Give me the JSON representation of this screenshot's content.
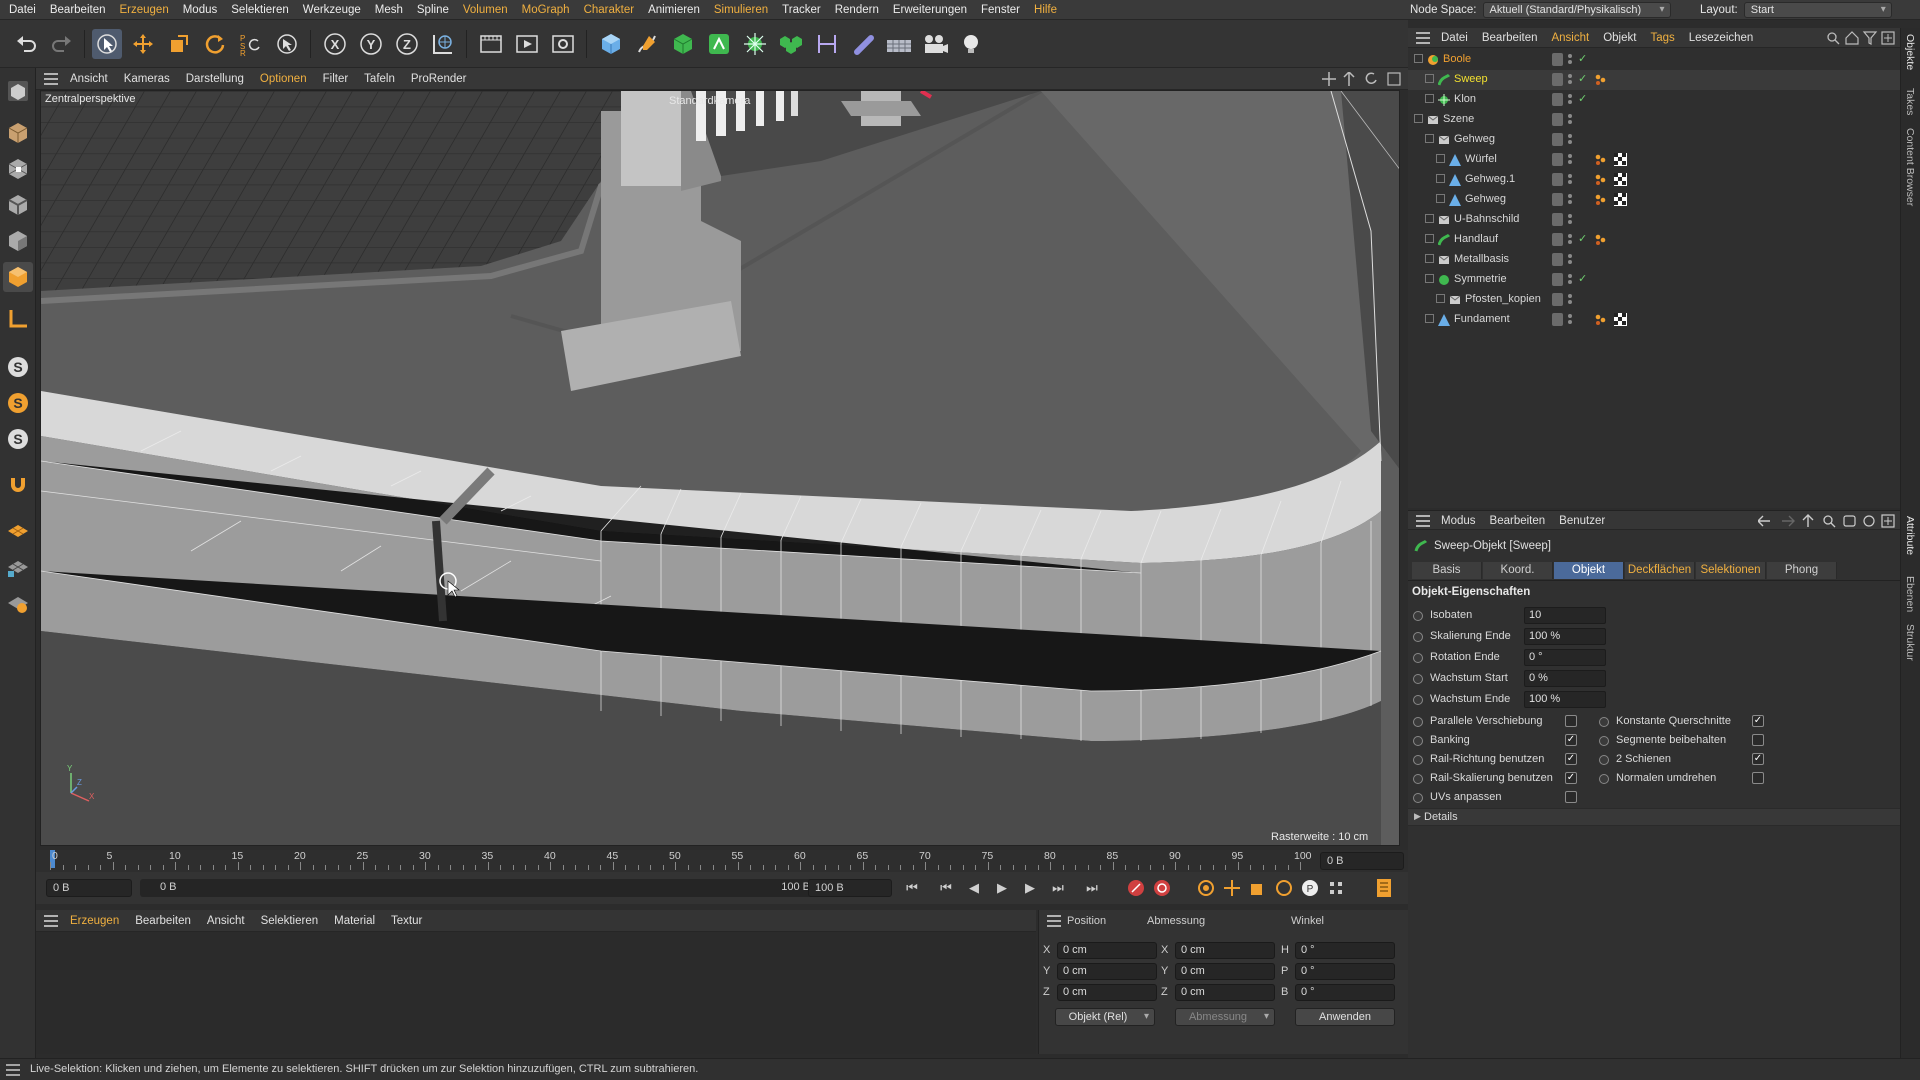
{
  "menubar": {
    "items": [
      "Datei",
      "Bearbeiten",
      "Erzeugen",
      "Modus",
      "Selektieren",
      "Werkzeuge",
      "Mesh",
      "Spline",
      "Volumen",
      "MoGraph",
      "Charakter",
      "Animieren",
      "Simulieren",
      "Tracker",
      "Rendern",
      "Erweiterungen",
      "Fenster",
      "Hilfe"
    ],
    "node_space_label": "Node Space:",
    "node_space_value": "Aktuell (Standard/Physikalisch)",
    "layout_label": "Layout:",
    "layout_value": "Start"
  },
  "toolbar": {
    "icons": [
      "undo-icon",
      "redo-icon",
      "live-selection-icon",
      "move-icon",
      "scale-icon",
      "rotate-icon",
      "psr-icon",
      "select-icon",
      "x-axis-icon",
      "y-axis-icon",
      "z-axis-icon",
      "world-coord-icon",
      "render-region-icon",
      "render-view-icon",
      "render-settings-icon",
      "cube-icon",
      "pen-icon",
      "subdivision-icon",
      "extrude-icon",
      "cloner-icon",
      "field-icon",
      "deformer-icon",
      "scene-icon",
      "floor-icon",
      "camera-icon",
      "light-icon"
    ],
    "axis_labels": [
      "X",
      "Y",
      "Z"
    ]
  },
  "left_tools": {
    "icons": [
      "make-editable-icon",
      "texture-mode-icon",
      "points-mode-icon",
      "edges-mode-icon",
      "polygons-mode-icon",
      "model-mode-icon",
      "axis-mode-icon",
      "snap-icon",
      "soft-selection-icon",
      "sculpt-icon",
      "magnet-icon",
      "workplane-icon",
      "grid-icon",
      "solo-icon"
    ]
  },
  "viewport": {
    "menu": [
      "Ansicht",
      "Kameras",
      "Darstellung",
      "Optionen",
      "Filter",
      "Tafeln",
      "ProRender"
    ],
    "view_name": "Zentralperspektive",
    "camera_name": "Standardkamera",
    "grid_info": "Rasterweite : 10 cm"
  },
  "timeline": {
    "ticks": [
      "0",
      "5",
      "10",
      "15",
      "20",
      "25",
      "30",
      "35",
      "40",
      "45",
      "50",
      "55",
      "60",
      "65",
      "70",
      "75",
      "80",
      "85",
      "90",
      "95",
      "100"
    ],
    "current_frame": "0 B",
    "start_frame": "0 B",
    "range_start": "0 B",
    "range_end": "100 B",
    "end_frame": "100 B"
  },
  "material_manager": {
    "menu": [
      "Erzeugen",
      "Bearbeiten",
      "Ansicht",
      "Selektieren",
      "Material",
      "Textur"
    ]
  },
  "coordinates": {
    "headers": [
      "Position",
      "Abmessung",
      "Winkel"
    ],
    "rows": [
      {
        "axis": "X",
        "pos": "0 cm",
        "size_axis": "X",
        "size": "0 cm",
        "rot_axis": "H",
        "rot": "0 °"
      },
      {
        "axis": "Y",
        "pos": "0 cm",
        "size_axis": "Y",
        "size": "0 cm",
        "rot_axis": "P",
        "rot": "0 °"
      },
      {
        "axis": "Z",
        "pos": "0 cm",
        "size_axis": "Z",
        "size": "0 cm",
        "rot_axis": "B",
        "rot": "0 °"
      }
    ],
    "mode": "Objekt (Rel)",
    "size_mode": "Abmessung",
    "apply": "Anwenden"
  },
  "object_manager": {
    "menu": [
      "Datei",
      "Bearbeiten",
      "Ansicht",
      "Objekt",
      "Tags",
      "Lesezeichen"
    ],
    "objects": [
      {
        "name": "Boole",
        "indent": 0,
        "color": "orange",
        "check": true,
        "tags": []
      },
      {
        "name": "Sweep",
        "indent": 1,
        "color": "yellow",
        "check": true,
        "tags": [
          "phong"
        ]
      },
      {
        "name": "Klon",
        "indent": 1,
        "color": "default",
        "check": true,
        "tags": []
      },
      {
        "name": "Szene",
        "indent": 0,
        "color": "default",
        "check": false,
        "tags": []
      },
      {
        "name": "Gehweg",
        "indent": 1,
        "color": "default",
        "check": false,
        "tags": []
      },
      {
        "name": "Würfel",
        "indent": 2,
        "color": "default",
        "check": false,
        "tags": [
          "phong",
          "material"
        ]
      },
      {
        "name": "Gehweg.1",
        "indent": 2,
        "color": "default",
        "check": false,
        "tags": [
          "phong",
          "material"
        ]
      },
      {
        "name": "Gehweg",
        "indent": 2,
        "color": "default",
        "check": false,
        "tags": [
          "phong",
          "material"
        ]
      },
      {
        "name": "U-Bahnschild",
        "indent": 1,
        "color": "default",
        "check": false,
        "tags": []
      },
      {
        "name": "Handlauf",
        "indent": 1,
        "color": "default",
        "check": true,
        "tags": [
          "phong"
        ]
      },
      {
        "name": "Metallbasis",
        "indent": 1,
        "color": "default",
        "check": false,
        "tags": []
      },
      {
        "name": "Symmetrie",
        "indent": 1,
        "color": "default",
        "check": true,
        "tags": []
      },
      {
        "name": "Pfosten_kopien",
        "indent": 2,
        "color": "default",
        "check": false,
        "tags": []
      },
      {
        "name": "Fundament",
        "indent": 1,
        "color": "default",
        "check": false,
        "tags": [
          "phong",
          "material"
        ]
      }
    ]
  },
  "attributes": {
    "menu": [
      "Modus",
      "Bearbeiten",
      "Benutzer"
    ],
    "object_title": "Sweep-Objekt [Sweep]",
    "tabs": [
      "Basis",
      "Koord.",
      "Objekt",
      "Deckflächen",
      "Selektionen",
      "Phong"
    ],
    "active_tab": "Objekt",
    "section": "Objekt-Eigenschaften",
    "fields": [
      {
        "label": "Isobaten",
        "value": "10"
      },
      {
        "label": "Skalierung Ende",
        "value": "100 %"
      },
      {
        "label": "Rotation Ende",
        "value": "0 °"
      },
      {
        "label": "Wachstum Start",
        "value": "0 %"
      },
      {
        "label": "Wachstum Ende",
        "value": "100 %"
      }
    ],
    "checks_left": [
      {
        "label": "Parallele Verschiebung",
        "checked": false
      },
      {
        "label": "Banking",
        "checked": true
      },
      {
        "label": "Rail-Richtung benutzen",
        "checked": true
      },
      {
        "label": "Rail-Skalierung benutzen",
        "checked": true
      },
      {
        "label": "UVs anpassen",
        "checked": false
      }
    ],
    "checks_right": [
      {
        "label": "Konstante Querschnitte",
        "checked": true
      },
      {
        "label": "Segmente beibehalten",
        "checked": false
      },
      {
        "label": "2 Schienen",
        "checked": true
      },
      {
        "label": "Normalen umdrehen",
        "checked": false
      }
    ],
    "details": "Details"
  },
  "side_tabs": [
    "Objekte",
    "Takes",
    "Content Browser",
    "Attribute",
    "Ebenen",
    "Struktur"
  ],
  "status": {
    "text": "Live-Selektion: Klicken und ziehen, um Elemente zu selektieren. SHIFT drücken um zur Selektion hinzuzufügen, CTRL zum subtrahieren."
  },
  "colors": {
    "accent": "#f0b040",
    "active_tab": "#4b6a9a",
    "sweep_yellow": "#f2e030",
    "boole_orange": "#f0a030"
  }
}
